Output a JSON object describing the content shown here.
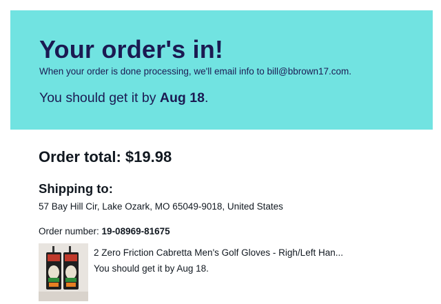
{
  "confirmation": {
    "title": "Your order's in!",
    "subtitle": "When your order is done processing, we'll email info to bill@bbrown17.com.",
    "eta_prefix": "You should get it by ",
    "eta_date": "Aug 18",
    "eta_suffix": "."
  },
  "order": {
    "total_label": "Order total:",
    "total_value": "$19.98",
    "shipping_heading": "Shipping to:",
    "shipping_address": "57 Bay Hill Cir, Lake Ozark, MO 65049-9018, United States",
    "number_label": "Order number: ",
    "number_value": "19-08969-81675"
  },
  "items": [
    {
      "title": "2 Zero Friction Cabretta Men's Golf Gloves - Righ/Left Han...",
      "eta": "You should get it by Aug 18.",
      "thumbnail_icon": "golf-gloves-product-photo"
    }
  ],
  "colors": {
    "banner_bg": "#71e3e1",
    "banner_text": "#1b1a52",
    "body_text": "#111820"
  }
}
